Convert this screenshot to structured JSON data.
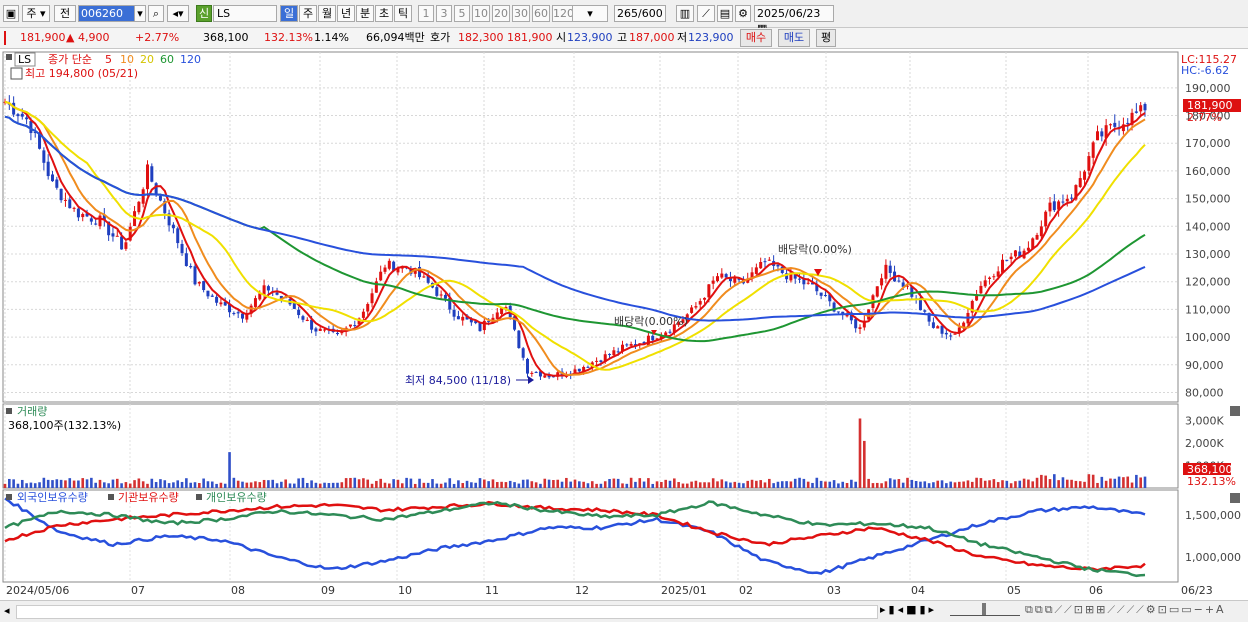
{
  "toolbar": {
    "market": "주",
    "prev_label": "전",
    "code": "006260",
    "new_label": "신",
    "name": "LS",
    "periods": [
      "일",
      "주",
      "월",
      "년",
      "분",
      "초",
      "틱"
    ],
    "active_period": "일",
    "intervals": [
      "1",
      "3",
      "5",
      "10",
      "20",
      "30",
      "60",
      "120"
    ],
    "count": "265",
    "count_total": "/600",
    "date": "2025/06/23"
  },
  "quote": {
    "price": "181,900",
    "change": "▲ 4,900",
    "change_pct": "+2.77%",
    "volume": "368,100",
    "volume_ratio": "132.13%",
    "turnover": "1.14%",
    "amount": "66,094백만",
    "ask_label": "호가",
    "ask1": "182,300",
    "ask2": "181,900",
    "open_label": "시",
    "open": "123,900",
    "high_label": "고",
    "high": "187,000",
    "low_label": "저",
    "low": "123,900",
    "buy_label": "매수",
    "sell_label": "매도",
    "eval_label": "평"
  },
  "price_panel": {
    "title": "LS",
    "ma_label": "종가 단순",
    "ma_periods": [
      "5",
      "10",
      "20",
      "60",
      "120"
    ],
    "ma_colors": [
      "#e01010",
      "#f08c1e",
      "#f0e000",
      "#1e9632",
      "#2850dc"
    ],
    "high_note": "최고 194,800 (05/21)",
    "low_note": "최저 84,500 (11/18)",
    "dividend_note1": "배당락(0.00%)",
    "dividend_note2": "배당락(0.00%)",
    "lc": "LC:115.27",
    "hc": "HC:-6.62",
    "price_tag": "181,900",
    "pct_tag": "2.77%"
  },
  "volume_panel": {
    "title": "거래량",
    "current": "368,100주(132.13%)",
    "tag1": "368,100",
    "tag2": "132.13%"
  },
  "investor_panel": {
    "series": [
      "외국인보유수량",
      "기관보유수량",
      "개인보유수량"
    ]
  },
  "date_axis": [
    "2024/05/06",
    "07",
    "08",
    "09",
    "10",
    "11",
    "12",
    "2025/01",
    "02",
    "03",
    "04",
    "05",
    "06",
    "06/23"
  ],
  "chart_data": [
    {
      "type": "line",
      "title": "",
      "y_ticks": [
        "190,000",
        "180,000",
        "170,000",
        "160,000",
        "150,000",
        "140,000",
        "130,000",
        "120,000",
        "110,000",
        "100,000",
        "90,000",
        "80,000"
      ],
      "ylim": [
        78000,
        195000
      ],
      "months": [
        "2024/05",
        "2024/06",
        "2024/07",
        "2024/08",
        "2024/09",
        "2024/10",
        "2024/11",
        "2024/12",
        "2025/01",
        "2025/02",
        "2025/03",
        "2025/04",
        "2025/05",
        "2025/06"
      ],
      "close": [
        185000,
        178000,
        155000,
        145000,
        142000,
        132000,
        160000,
        140000,
        120000,
        112000,
        108000,
        118000,
        112000,
        103000,
        100000,
        108000,
        126000,
        125000,
        118000,
        108000,
        103000,
        113000,
        88000,
        86000,
        88000,
        92000,
        96000,
        99000,
        103000,
        110000,
        122000,
        119000,
        127000,
        122000,
        118000,
        110000,
        103000,
        125000,
        118000,
        104000,
        100000,
        118000,
        127000,
        132000,
        147000,
        152000,
        172000,
        178000,
        181900
      ],
      "series": [
        {
          "name": "5",
          "color": "#e01010"
        },
        {
          "name": "10",
          "color": "#f08c1e"
        },
        {
          "name": "20",
          "color": "#f0e000"
        },
        {
          "name": "60",
          "color": "#1e9632"
        },
        {
          "name": "120",
          "color": "#2850dc"
        }
      ]
    },
    {
      "type": "bar",
      "title": "거래량",
      "y_ticks": [
        "3,000K",
        "2,000K",
        "1,000K"
      ]
    },
    {
      "type": "line",
      "title": "",
      "y_ticks": [
        "1,500,000",
        "1,000,000"
      ],
      "series": [
        {
          "name": "외국인보유수량",
          "color": "#2850dc"
        },
        {
          "name": "기관보유수량",
          "color": "#e01010"
        },
        {
          "name": "개인보유수량",
          "color": "#2e8b57"
        }
      ]
    }
  ]
}
